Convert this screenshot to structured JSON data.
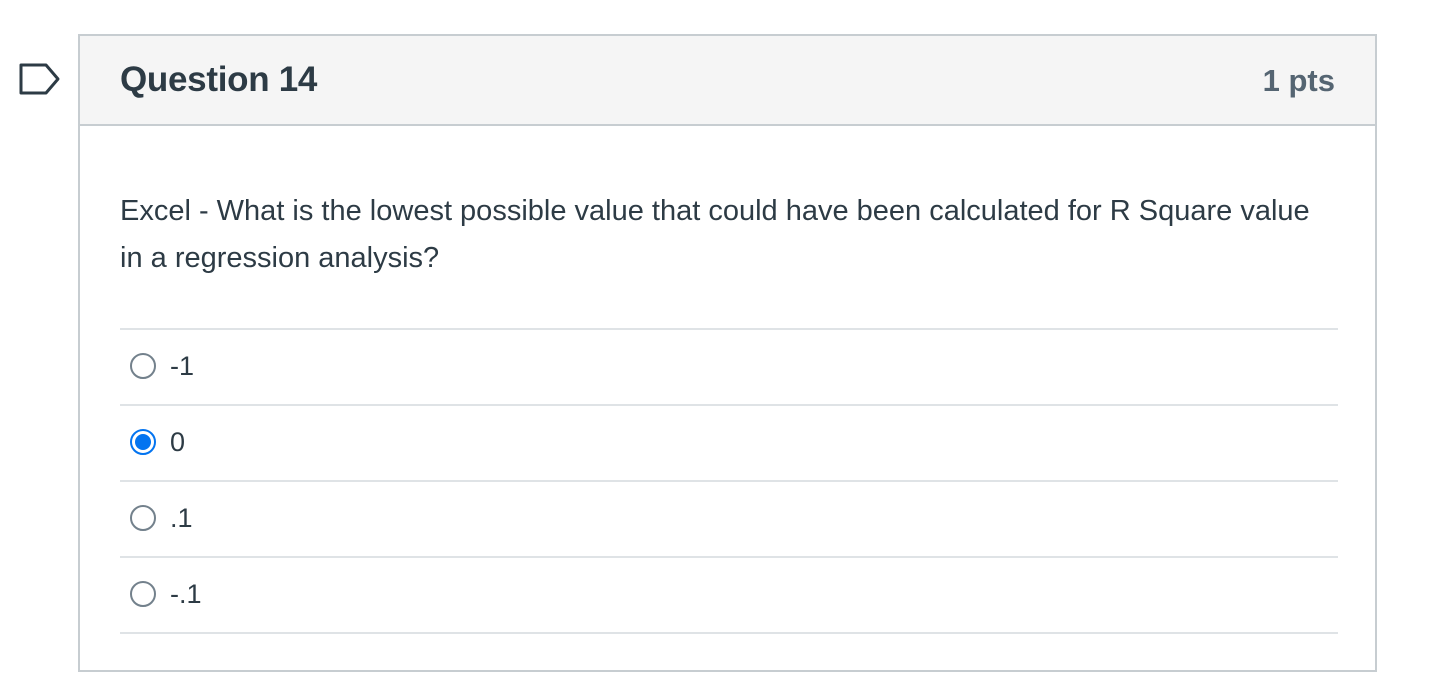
{
  "question": {
    "title": "Question 14",
    "points": "1 pts",
    "text": "Excel - What is the lowest possible value that could have been calculated for R Square value in a regression analysis?",
    "flag_icon": "bookmark-flag-icon",
    "answers": [
      {
        "label": "-1",
        "selected": false
      },
      {
        "label": "0",
        "selected": true
      },
      {
        "label": ".1",
        "selected": false
      },
      {
        "label": "-.1",
        "selected": false
      }
    ]
  },
  "colors": {
    "accent": "#0374f0",
    "header_bg": "#f5f5f5",
    "border": "#c7cdd1",
    "text": "#2d3b45"
  }
}
